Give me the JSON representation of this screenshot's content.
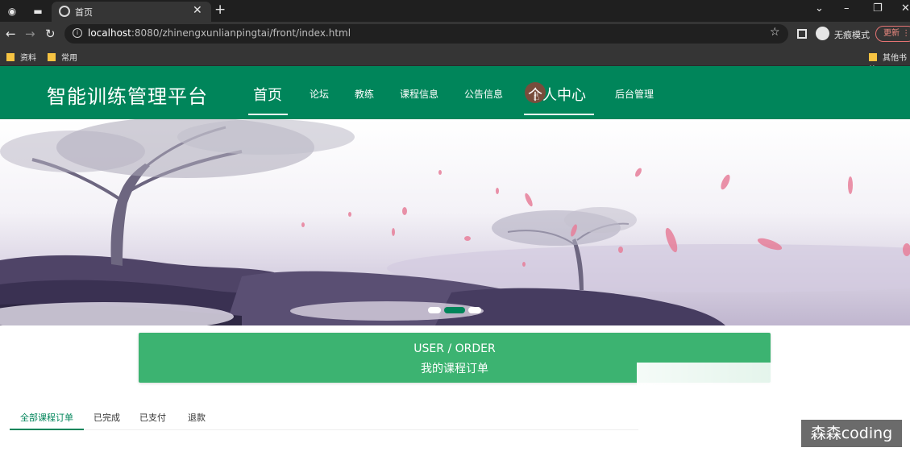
{
  "browser": {
    "tab_title": "首页",
    "url_host": "localhost",
    "url_rest": ":8080/zhinengxunlianpingtai/front/index.html",
    "incognito_label": "无痕模式",
    "update_label": "更新",
    "bookmarks": [
      "资料",
      "常用"
    ],
    "other_bookmarks": "其他书签"
  },
  "site": {
    "brand": "智能训练管理平台",
    "nav": [
      {
        "label": "首页"
      },
      {
        "label": "论坛"
      },
      {
        "label": "教练"
      },
      {
        "label": "课程信息"
      },
      {
        "label": "公告信息"
      },
      {
        "label": "个人中心"
      },
      {
        "label": "后台管理"
      }
    ],
    "active_nav": "首页",
    "hover_nav": "个人中心"
  },
  "carousel": {
    "slides_count": 3,
    "active_index": 1
  },
  "order_header": {
    "title_en": "USER / ORDER",
    "title_cn": "我的课程订单"
  },
  "order_tabs": [
    {
      "label": "全部课程订单",
      "active": true
    },
    {
      "label": "已完成",
      "active": false
    },
    {
      "label": "已支付",
      "active": false
    },
    {
      "label": "退款",
      "active": false
    }
  ],
  "watermark": "森森coding",
  "colors": {
    "nav_green": "#00855a",
    "card_green": "#3cb371",
    "browser_dark": "#353535"
  }
}
